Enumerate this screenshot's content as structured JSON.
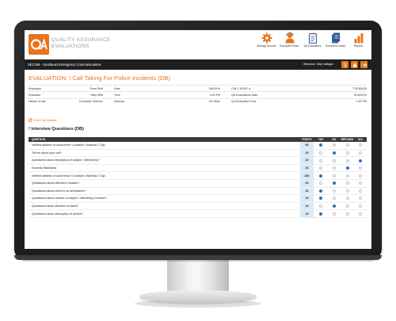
{
  "app": {
    "title": "QUALITY ASSURANCE",
    "subtitle": "EVALUATIONS"
  },
  "nav": [
    {
      "label": "Manage Account",
      "icon": "gear-icon",
      "color": "#e8731b"
    },
    {
      "label": "Employee Roster",
      "icon": "employee-icon",
      "color": "#e8731b"
    },
    {
      "label": "QA Evaluations",
      "icon": "clipboard-icon",
      "color": "#3a6bb5"
    },
    {
      "label": "Document Library",
      "icon": "documents-icon",
      "color": "#3a6bb5"
    },
    {
      "label": "Reports",
      "icon": "bar-chart-icon",
      "color": "#e8731b"
    }
  ],
  "bar": {
    "org": "SECOM - Southeast Emergency Communications",
    "welcome": "Welcome: Vilay Vattigan",
    "buttons": [
      "info-icon",
      "lock-icon",
      "logout-icon"
    ]
  },
  "evaluation": {
    "title": "EVALUATION: ! Call Taking For Police Incidents (DB)",
    "info_rows": [
      [
        "Employee",
        "Russ Reid",
        "Date",
        "5/8/2019",
        "CAD / DVDIT #",
        "778765426"
      ],
      [
        "Evaluator",
        "Vilay Wild",
        "Time",
        "3:02 PM",
        "QA Evaluations Date",
        "5/15/2019"
      ],
      [
        "Nature of call",
        "Domestic Violence",
        "Address",
        "123 Main",
        "QA Evaluation Time",
        "1:50 PM"
      ]
    ],
    "edit_link": "Edit Call Details",
    "section_title": "! Interview Questions (DB)"
  },
  "questions": {
    "headers": [
      "QUESTION",
      "POINTS",
      "YES",
      "NO",
      "REFUSED",
      "N/A"
    ],
    "rows": [
      {
        "q": "Verified address of occurrence? (Location / Address / City)",
        "points": "60",
        "sel": 0
      },
      {
        "q": "Tell me about your call?",
        "points": "20",
        "sel": 1
      },
      {
        "q": "Questioned about description of subject / offender(s)?",
        "points": "20",
        "sel": 3
      },
      {
        "q": "Exceeds Standards",
        "points": "20",
        "sel": 2
      },
      {
        "q": "Verified address of occurrence? (Location / Address / City)",
        "points": "200",
        "sel": 0
      },
      {
        "q": "Questioned about offender's location?",
        "points": "20",
        "sel": 1
      },
      {
        "q": "Questioned about need for an ambulance?",
        "points": "20",
        "sel": 0
      },
      {
        "q": "Questioned about number of subject / offender(s) involved?",
        "points": "20",
        "sel": 0
      },
      {
        "q": "Questioned about direction of travel?",
        "points": "20",
        "sel": 1
      },
      {
        "q": "Questioned about description of vehicle?",
        "points": "10",
        "sel": 0
      }
    ]
  }
}
